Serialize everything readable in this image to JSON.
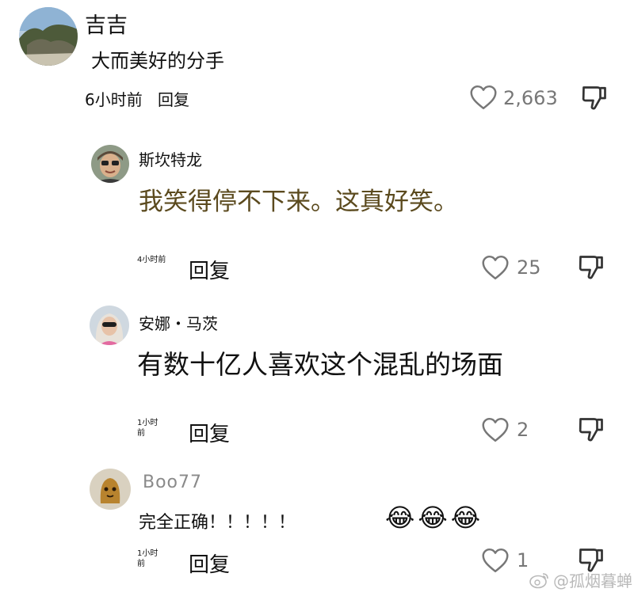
{
  "comments": [
    {
      "author": "吉吉",
      "text": "大而美好的分手",
      "time": "6小时前",
      "reply_label": "回复",
      "likes": "2,663"
    }
  ],
  "replies": [
    {
      "author": "斯坎特龙",
      "text": "我笑得停不下来。这真好笑。",
      "text_color": "#5b4a1e",
      "time": "4小时前",
      "reply_label": "回复",
      "likes": "25"
    },
    {
      "author": "安娜・马茨",
      "text": "有数十亿人喜欢这个混乱的场面",
      "time_line1": "1小时",
      "time_line2": "前",
      "reply_label": "回复",
      "likes": "2"
    },
    {
      "author": "Boo77",
      "text": "完全正确！！！！！",
      "emoji": [
        "😂",
        "😂",
        "😂"
      ],
      "time_line1": "1小时",
      "time_line2": "前",
      "reply_label": "回复",
      "likes": "1"
    }
  ],
  "icons": {
    "like": "heart-outline-icon",
    "dislike": "thumbs-down-icon",
    "weibo": "weibo-logo-icon"
  },
  "watermark": "@孤烟暮蝉"
}
